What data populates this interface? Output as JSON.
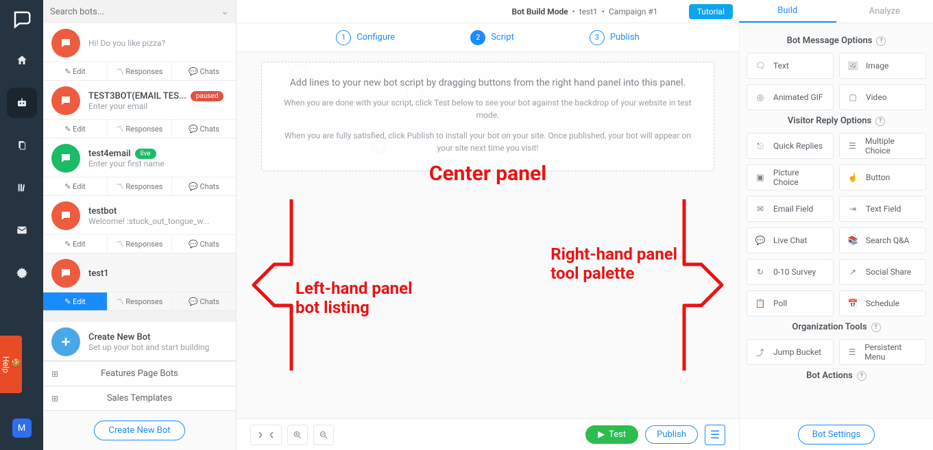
{
  "header": {
    "mode": "Bot Build Mode",
    "bot": "test1",
    "campaign": "Campaign #1",
    "tutorial": "Tutorial"
  },
  "nav": {
    "avatar_initial": "M",
    "help": "Help"
  },
  "sidebar": {
    "search_placeholder": "Search bots...",
    "bots": [
      {
        "title": "",
        "subtitle": "Hi! Do you like pizza?",
        "avatar": "red",
        "badge": null
      },
      {
        "title": "TEST3BOT(EMAIL TES...",
        "subtitle": "Enter your email",
        "avatar": "red",
        "badge": "paused"
      },
      {
        "title": "test4email",
        "subtitle": "Enter your first name",
        "avatar": "green",
        "badge": "live"
      },
      {
        "title": "testbot",
        "subtitle": "Welcome! :stuck_out_tongue_w...",
        "avatar": "red",
        "badge": null
      },
      {
        "title": "test1",
        "subtitle": "",
        "avatar": "red",
        "badge": null,
        "selected": true
      }
    ],
    "actions": {
      "edit": "Edit",
      "responses": "Responses",
      "chats": "Chats"
    },
    "create": {
      "title": "Create New Bot",
      "subtitle": "Set up your bot and start building"
    },
    "accordion": [
      "Features Page Bots",
      "Sales Templates"
    ],
    "footer_cta": "Create New Bot"
  },
  "stepper": [
    {
      "num": "1",
      "label": "Configure"
    },
    {
      "num": "2",
      "label": "Script"
    },
    {
      "num": "3",
      "label": "Publish"
    }
  ],
  "dropzone": {
    "title": "Add lines to your new bot script by dragging buttons from the right hand panel into this panel.",
    "sub1": "When you are done with your script, click Test below to see your bot against the backdrop of your website in test mode.",
    "sub2": "When you are fully satisfied, click Publish to install your bot on your site. Once published, your bot will appear on your site next time you visit!"
  },
  "annotations": {
    "center": "Center panel",
    "left1": "Left-hand panel",
    "left2": "bot listing",
    "right1": "Right-hand panel",
    "right2": "tool palette"
  },
  "canvas_footer": {
    "test": "Test",
    "publish": "Publish"
  },
  "right_tabs": [
    "Build",
    "Analyze"
  ],
  "palette": {
    "sections": [
      {
        "title": "Bot Message Options",
        "tools": [
          "Text",
          "Image",
          "Animated GIF",
          "Video"
        ]
      },
      {
        "title": "Visitor Reply Options",
        "tools": [
          "Quick Replies",
          "Multiple Choice",
          "Picture Choice",
          "Button",
          "Email Field",
          "Text Field",
          "Live Chat",
          "Search Q&A",
          "0-10 Survey",
          "Social Share",
          "Poll",
          "Schedule"
        ]
      },
      {
        "title": "Organization Tools",
        "tools": [
          "Jump Bucket",
          "Persistent Menu"
        ]
      },
      {
        "title": "Bot Actions",
        "tools": []
      }
    ],
    "footer_cta": "Bot Settings"
  },
  "icons": {
    "text": "🗨",
    "image": "🖼",
    "gif": "◎",
    "video": "▢",
    "quick": "⎋",
    "multi": "☰",
    "picchoice": "▣",
    "button": "☝",
    "email": "✉",
    "textfield": "⇥",
    "livechat": "💬",
    "search": "📚",
    "survey": "↻",
    "share": "↗",
    "poll": "📋",
    "schedule": "📅",
    "jump": "⤴",
    "pmenu": "☰"
  }
}
